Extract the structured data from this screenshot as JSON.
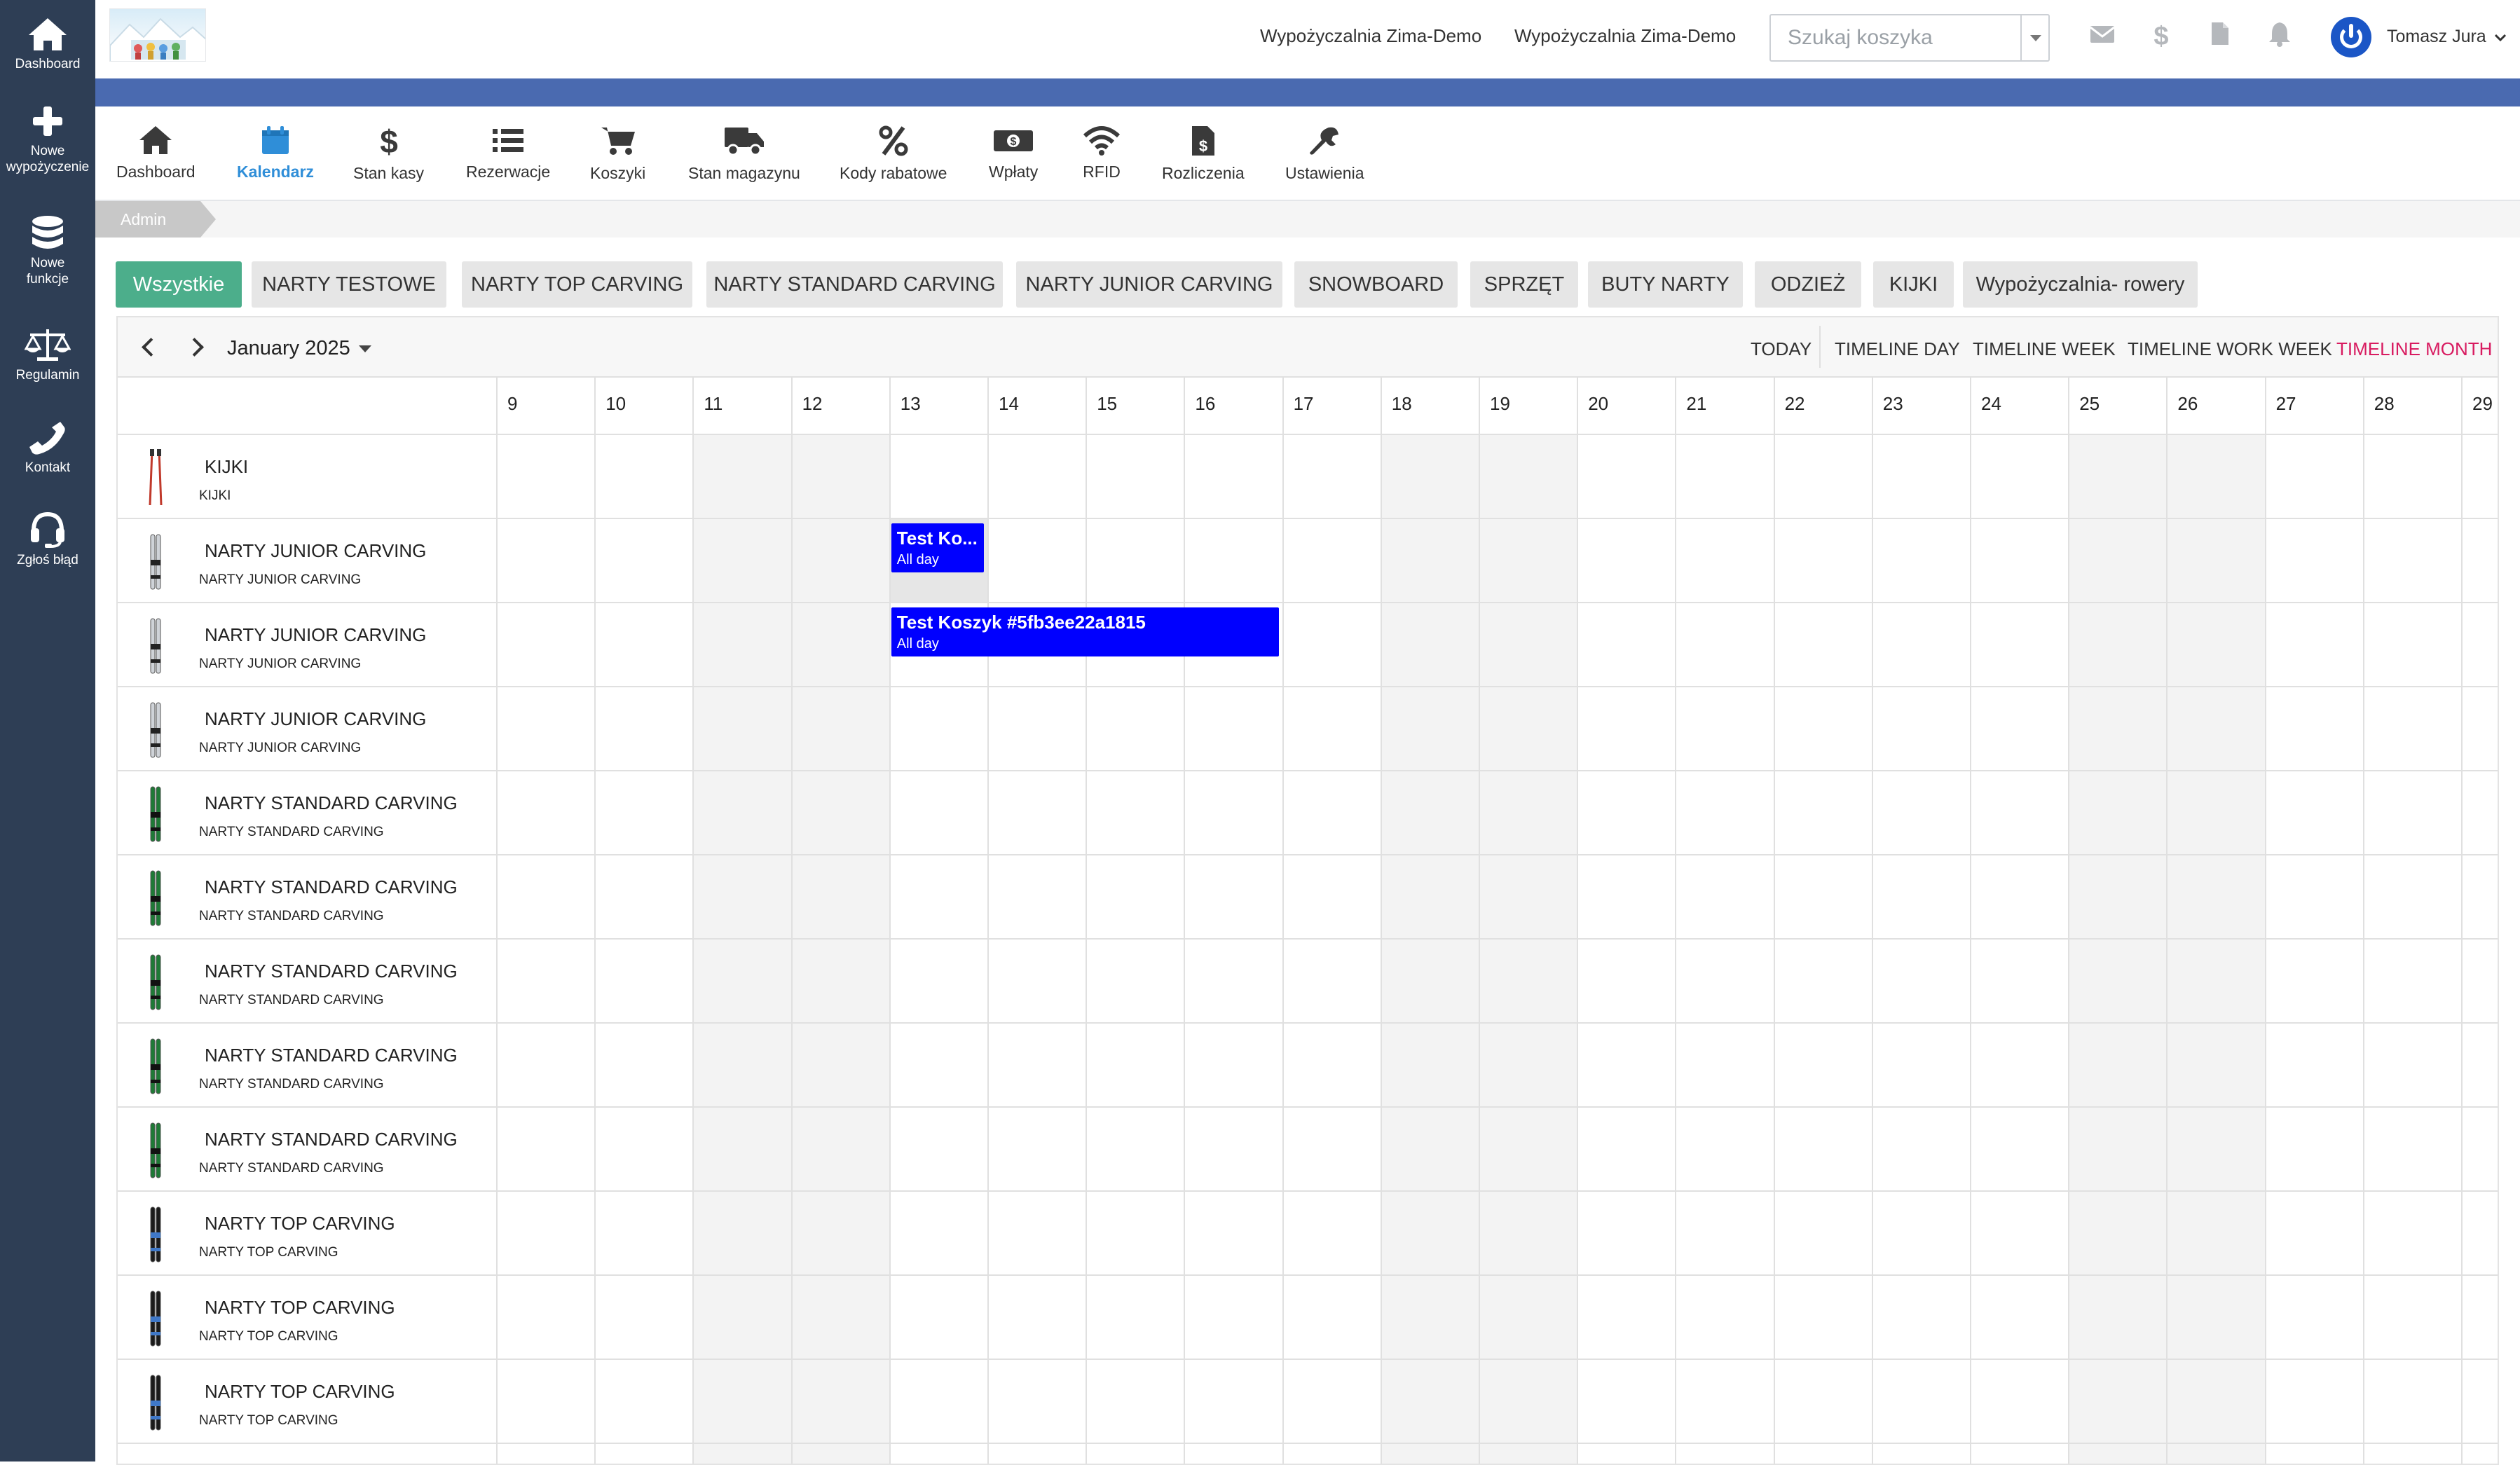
{
  "sidebar": {
    "items": [
      {
        "label": "Dashboard",
        "icon": "home-icon"
      },
      {
        "label": "Nowe wypożyczenie",
        "icon": "plus-icon"
      },
      {
        "label": "Nowe funkcje",
        "icon": "database-icon"
      },
      {
        "label": "Regulamin",
        "icon": "balance-scale-icon"
      },
      {
        "label": "Kontakt",
        "icon": "phone-icon"
      },
      {
        "label": "Zgłoś błąd",
        "icon": "headset-icon"
      }
    ]
  },
  "header": {
    "rental_names": [
      "Wypożyczalnia Zima-Demo",
      "Wypożyczalnia Zima-Demo"
    ],
    "search_placeholder": "Szukaj koszyka",
    "user_name": "Tomasz Jura"
  },
  "topnav": {
    "items": [
      {
        "label": "Dashboard",
        "icon": "home-icon"
      },
      {
        "label": "Kalendarz",
        "icon": "calendar-icon",
        "active": true
      },
      {
        "label": "Stan kasy",
        "icon": "dollar-icon"
      },
      {
        "label": "Rezerwacje",
        "icon": "list-icon"
      },
      {
        "label": "Koszyki",
        "icon": "cart-icon"
      },
      {
        "label": "Stan magazynu",
        "icon": "truck-icon"
      },
      {
        "label": "Kody rabatowe",
        "icon": "percent-icon"
      },
      {
        "label": "Wpłaty",
        "icon": "money-icon"
      },
      {
        "label": "RFID",
        "icon": "wifi-icon"
      },
      {
        "label": "Rozliczenia",
        "icon": "invoice-icon"
      },
      {
        "label": "Ustawienia",
        "icon": "wrench-icon"
      }
    ]
  },
  "breadcrumb": {
    "label": "Admin"
  },
  "filters": [
    "Wszystkie",
    "NARTY TESTOWE",
    "NARTY TOP CARVING",
    "NARTY STANDARD CARVING",
    "NARTY JUNIOR CARVING",
    "SNOWBOARD",
    "SPRZĘT",
    "BUTY NARTY",
    "ODZIEŻ",
    "KIJKI",
    "Wypożyczalnia- rowery"
  ],
  "active_filter": "Wszystkie",
  "calendar": {
    "month_label": "January 2025",
    "views": [
      "TODAY",
      "TIMELINE DAY",
      "TIMELINE WEEK",
      "TIMELINE WORK WEEK",
      "TIMELINE MONTH"
    ],
    "active_view": "TIMELINE MONTH",
    "days": [
      "9",
      "10",
      "11",
      "12",
      "13",
      "14",
      "15",
      "16",
      "17",
      "18",
      "19",
      "20",
      "21",
      "22",
      "23",
      "24",
      "25",
      "26",
      "27",
      "28",
      "29"
    ],
    "weekend_days": [
      "11",
      "12",
      "18",
      "19",
      "25",
      "26"
    ],
    "resources": [
      {
        "title": "KIJKI",
        "subtitle": "KIJKI",
        "kind": "pole"
      },
      {
        "title": "NARTY JUNIOR CARVING",
        "subtitle": "NARTY JUNIOR CARVING",
        "kind": "junior"
      },
      {
        "title": "NARTY JUNIOR CARVING",
        "subtitle": "NARTY JUNIOR CARVING",
        "kind": "junior"
      },
      {
        "title": "NARTY JUNIOR CARVING",
        "subtitle": "NARTY JUNIOR CARVING",
        "kind": "junior"
      },
      {
        "title": "NARTY STANDARD CARVING",
        "subtitle": "NARTY STANDARD CARVING",
        "kind": "standard"
      },
      {
        "title": "NARTY STANDARD CARVING",
        "subtitle": "NARTY STANDARD CARVING",
        "kind": "standard"
      },
      {
        "title": "NARTY STANDARD CARVING",
        "subtitle": "NARTY STANDARD CARVING",
        "kind": "standard"
      },
      {
        "title": "NARTY STANDARD CARVING",
        "subtitle": "NARTY STANDARD CARVING",
        "kind": "standard"
      },
      {
        "title": "NARTY STANDARD CARVING",
        "subtitle": "NARTY STANDARD CARVING",
        "kind": "standard"
      },
      {
        "title": "NARTY TOP CARVING",
        "subtitle": "NARTY TOP CARVING",
        "kind": "top"
      },
      {
        "title": "NARTY TOP CARVING",
        "subtitle": "NARTY TOP CARVING",
        "kind": "top"
      },
      {
        "title": "NARTY TOP CARVING",
        "subtitle": "NARTY TOP CARVING",
        "kind": "top"
      }
    ],
    "events": [
      {
        "row": 1,
        "start_day": "13",
        "end_day": "13",
        "title": "Test Ko...",
        "subtitle": "All day"
      },
      {
        "row": 2,
        "start_day": "13",
        "end_day": "16",
        "title": "Test Koszyk #5fb3ee22a1815",
        "subtitle": "All day"
      }
    ],
    "event_color": "#0000ff",
    "highlight_color": "#e6e6e6",
    "weekend_color": "#f3f3f3"
  }
}
